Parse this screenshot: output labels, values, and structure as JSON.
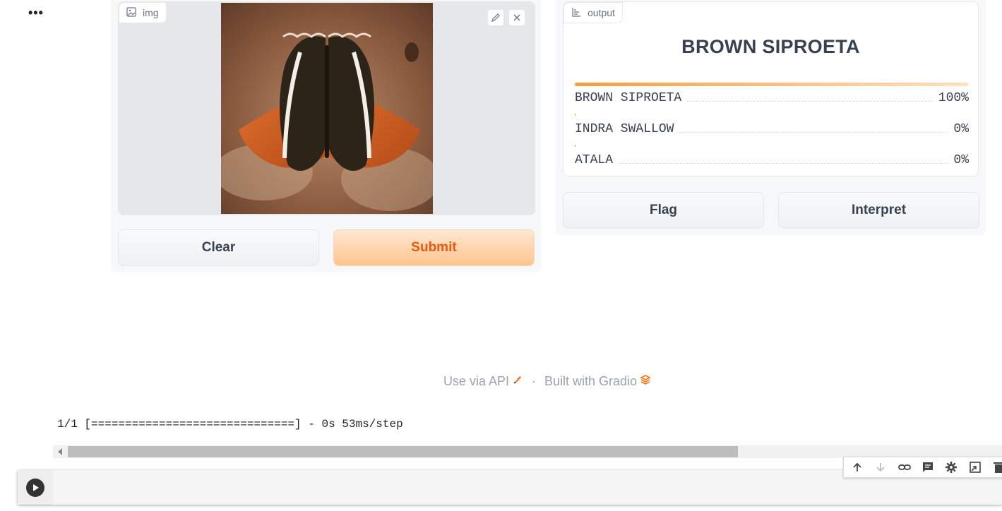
{
  "menu": {
    "ellipsis": "•••"
  },
  "input": {
    "label": "img",
    "clear_label": "Clear",
    "submit_label": "Submit"
  },
  "output": {
    "label": "output",
    "top_label": "BROWN SIPROETA",
    "confidences": [
      {
        "label": "BROWN SIPROETA",
        "value": "100%",
        "fraction": 1.0
      },
      {
        "label": "INDRA SWALLOW",
        "value": "0%",
        "fraction": 0.0
      },
      {
        "label": "ATALA",
        "value": "0%",
        "fraction": 0.0
      }
    ],
    "flag_label": "Flag",
    "interpret_label": "Interpret"
  },
  "footer": {
    "api_text": "Use via API",
    "separator": "·",
    "built_text": "Built with Gradio"
  },
  "console": {
    "log_line": "1/1 [==============================] - 0s 53ms/step"
  },
  "colors": {
    "accent_orange": "#ea580c",
    "bar_orange": "#f59e42"
  }
}
